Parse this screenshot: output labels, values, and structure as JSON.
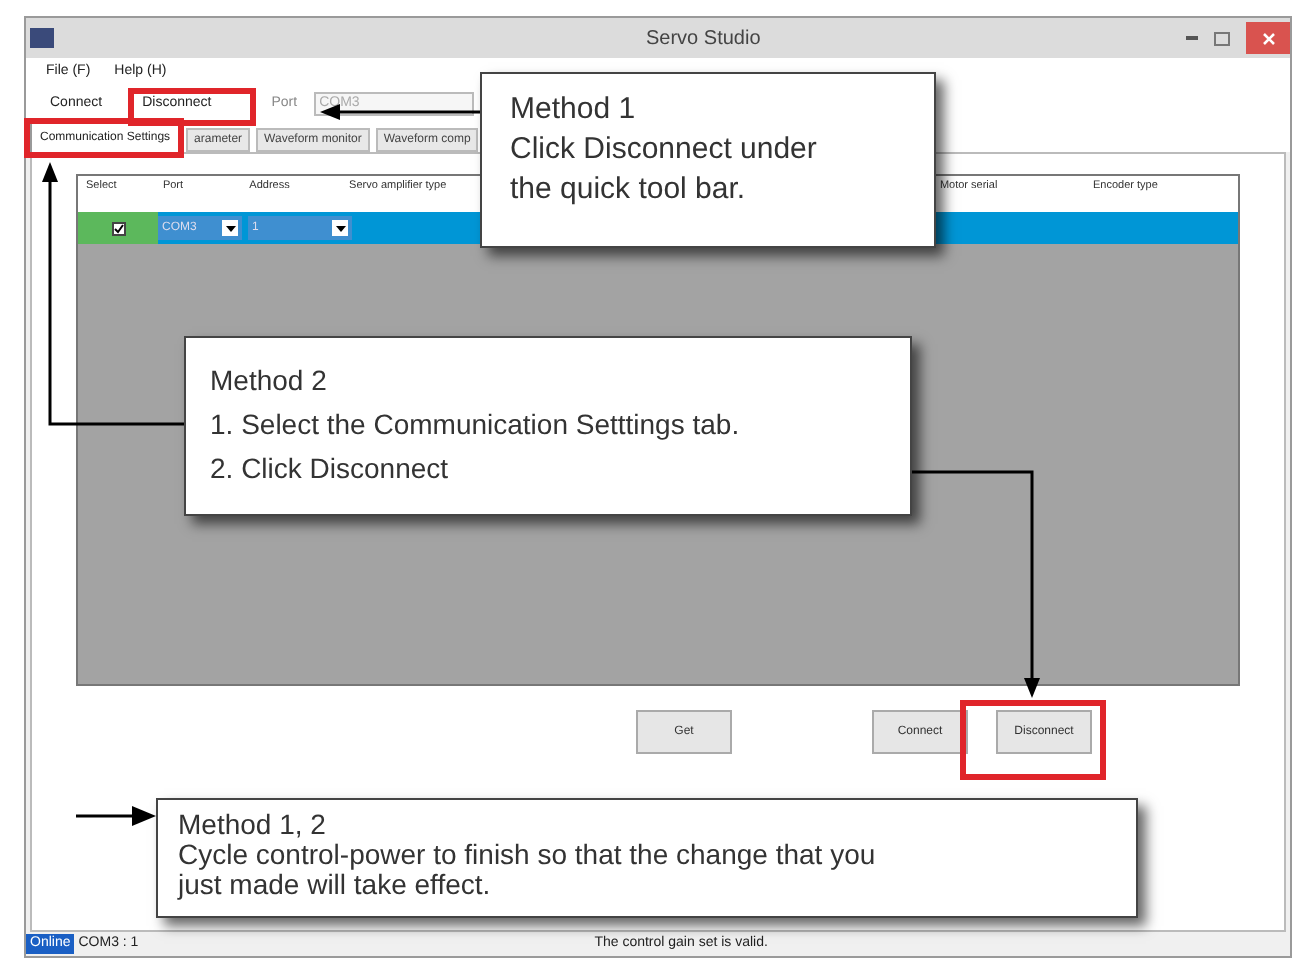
{
  "window": {
    "title": "Servo Studio"
  },
  "menu": [
    "File (F)",
    "Help (H)"
  ],
  "toolbar": {
    "buttons": [
      "Connect",
      "Disconnect"
    ],
    "port_label": "Port",
    "port_value": "COM3"
  },
  "tabs": [
    {
      "label": "Communication Settings",
      "selected": true
    },
    {
      "label": "arameter",
      "selected": false
    },
    {
      "label": "Waveform monitor",
      "selected": false
    },
    {
      "label": "Waveform comp",
      "selected": false
    }
  ],
  "table": {
    "columns": [
      "Select",
      "Port",
      "Address",
      "Servo amplifier type",
      "Motor serial",
      "Encoder type"
    ],
    "rows": [
      {
        "checked": true,
        "selected": true,
        "port": "COM3",
        "address": "1"
      }
    ]
  },
  "buttons": [
    "Get",
    "Connect",
    "Disconnect"
  ],
  "status_bar": {
    "state": "Online",
    "port": "COM3 : 1",
    "message": "The control gain set is valid."
  },
  "callouts": [
    {
      "lines": [
        "Method 1",
        "Click Disconnect under",
        "the quick tool bar."
      ]
    },
    {
      "lines": [
        "Method 2",
        "1. Select the Communication Setttings tab.",
        "2. Click Disconnect"
      ]
    },
    {
      "lines": [
        "Method 1, 2",
        "Cycle control-power to finish so that the change that you",
        "just made will take effect."
      ]
    }
  ]
}
